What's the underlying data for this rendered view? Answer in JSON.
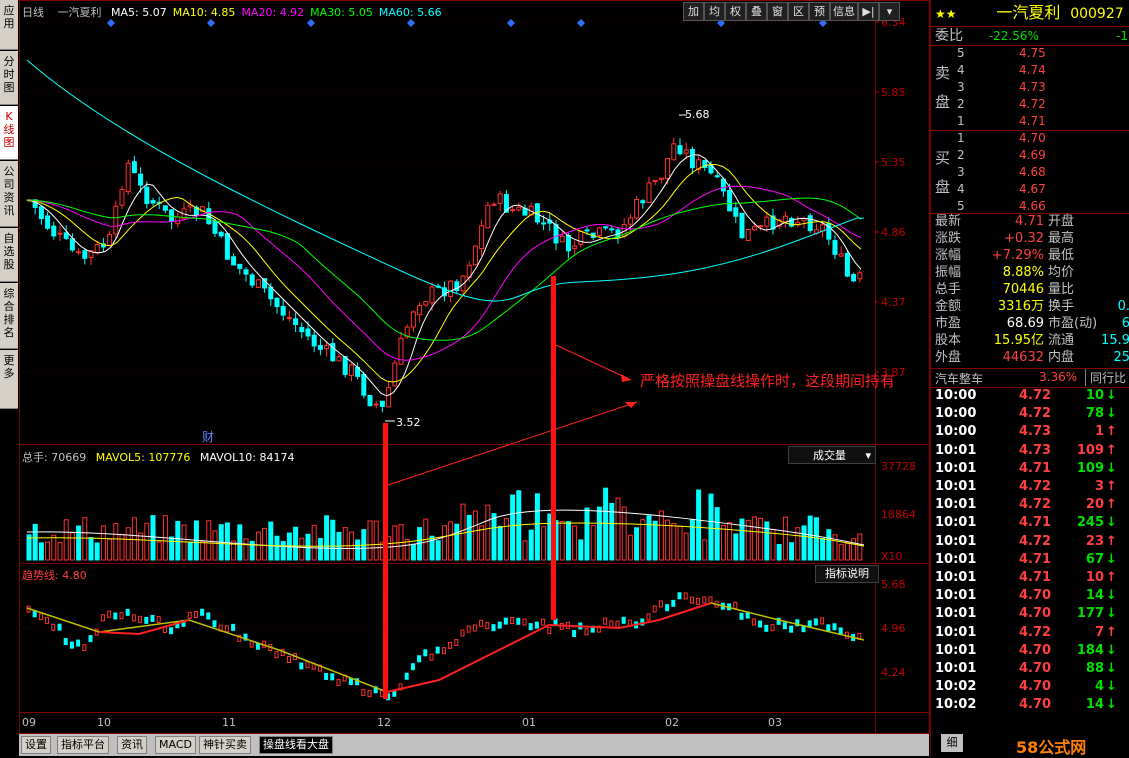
{
  "left_tabs": [
    "应用",
    "分时图",
    "K线图",
    "公司资讯",
    "自选股",
    "综合排名",
    "更多"
  ],
  "header": {
    "period": "日线",
    "stock": "一汽夏利",
    "ma": [
      {
        "label": "MA5: 5.07",
        "color": "#ffffff"
      },
      {
        "label": "MA10: 4.85",
        "color": "#ffff00"
      },
      {
        "label": "MA20: 4.92",
        "color": "#ff00ff"
      },
      {
        "label": "MA30: 5.05",
        "color": "#00ff00"
      },
      {
        "label": "MA60: 5.66",
        "color": "#00ffff"
      }
    ]
  },
  "toolbar": [
    "加",
    "均",
    "权",
    "叠",
    "窗",
    "区",
    "预",
    "信息",
    "▶|",
    "▾"
  ],
  "price_axis": [
    "6.34",
    "5.85",
    "5.35",
    "4.86",
    "4.37",
    "3.87"
  ],
  "annotations": {
    "high": "5.68",
    "low": "3.52",
    "cai": "财",
    "note": "严格按照操盘线操作时，这段期间持有"
  },
  "volume_header": {
    "total": "总手: 70669",
    "mavol5": "MAVOL5: 107776",
    "mavol10": "MAVOL10: 84174",
    "select": "成交量"
  },
  "volume_axis": [
    "37728",
    "18864",
    "X10"
  ],
  "indicator_header": {
    "label": "趋势线: 4.80",
    "button": "指标说明"
  },
  "indicator_axis": [
    "5.68",
    "4.96",
    "4.24"
  ],
  "x_axis": [
    "09",
    "10",
    "11",
    "12",
    "01",
    "02",
    "03"
  ],
  "bottom_tabs": [
    "设置",
    "指标平台",
    "资讯",
    "MACD",
    "神针买卖",
    "操盘线看大盘"
  ],
  "right": {
    "stock_name": "一汽夏利",
    "code": "000927",
    "wei_bi_label": "委比",
    "wei_bi": "-22.56%",
    "wei_bi_extra": "-1",
    "sell_label": "卖盘",
    "buy_label": "买盘",
    "sell": [
      [
        "5",
        "4.75"
      ],
      [
        "4",
        "4.74"
      ],
      [
        "3",
        "4.73"
      ],
      [
        "2",
        "4.72"
      ],
      [
        "1",
        "4.71"
      ]
    ],
    "buy": [
      [
        "1",
        "4.70"
      ],
      [
        "2",
        "4.69"
      ],
      [
        "3",
        "4.68"
      ],
      [
        "4",
        "4.67"
      ],
      [
        "5",
        "4.66"
      ]
    ],
    "stats": [
      {
        "l": "最新",
        "v": "4.71",
        "c": "red",
        "l2": "开盘",
        "v2": ""
      },
      {
        "l": "涨跌",
        "v": "+0.32",
        "c": "red",
        "l2": "最高",
        "v2": ""
      },
      {
        "l": "涨幅",
        "v": "+7.29%",
        "c": "red",
        "l2": "最低",
        "v2": ""
      },
      {
        "l": "振幅",
        "v": "8.88%",
        "c": "yel",
        "l2": "均价",
        "v2": ""
      },
      {
        "l": "总手",
        "v": "70446",
        "c": "yel",
        "l2": "量比",
        "v2": ""
      },
      {
        "l": "金额",
        "v": "3316万",
        "c": "yel",
        "l2": "换手",
        "v2": "0."
      },
      {
        "l": "市盈",
        "v": "68.69",
        "c": "wht",
        "l2": "市盈(动)",
        "v2": "6"
      },
      {
        "l": "股本",
        "v": "15.95亿",
        "c": "yel",
        "l2": "流通",
        "v2": "15.9"
      },
      {
        "l": "外盘",
        "v": "44632",
        "c": "red",
        "l2": "内盘",
        "v2": "25"
      }
    ],
    "sector": {
      "name": "汽车整车",
      "pct": "3.36%",
      "btn": "同行比"
    },
    "ticks": [
      [
        "10:00",
        "4.72",
        "10",
        "d"
      ],
      [
        "10:00",
        "4.72",
        "78",
        "d"
      ],
      [
        "10:00",
        "4.73",
        "1",
        "u"
      ],
      [
        "10:01",
        "4.73",
        "109",
        "u"
      ],
      [
        "10:01",
        "4.71",
        "109",
        "d"
      ],
      [
        "10:01",
        "4.72",
        "3",
        "u"
      ],
      [
        "10:01",
        "4.72",
        "20",
        "u"
      ],
      [
        "10:01",
        "4.71",
        "245",
        "d"
      ],
      [
        "10:01",
        "4.72",
        "23",
        "u"
      ],
      [
        "10:01",
        "4.71",
        "67",
        "d"
      ],
      [
        "10:01",
        "4.71",
        "10",
        "u"
      ],
      [
        "10:01",
        "4.70",
        "14",
        "d"
      ],
      [
        "10:01",
        "4.70",
        "177",
        "d"
      ],
      [
        "10:01",
        "4.72",
        "7",
        "u"
      ],
      [
        "10:01",
        "4.70",
        "184",
        "d"
      ],
      [
        "10:01",
        "4.70",
        "88",
        "d"
      ],
      [
        "10:02",
        "4.70",
        "4",
        "d"
      ],
      [
        "10:02",
        "4.70",
        "14",
        "d"
      ]
    ],
    "footer_btn": "细",
    "watermark": "58公式网"
  }
}
